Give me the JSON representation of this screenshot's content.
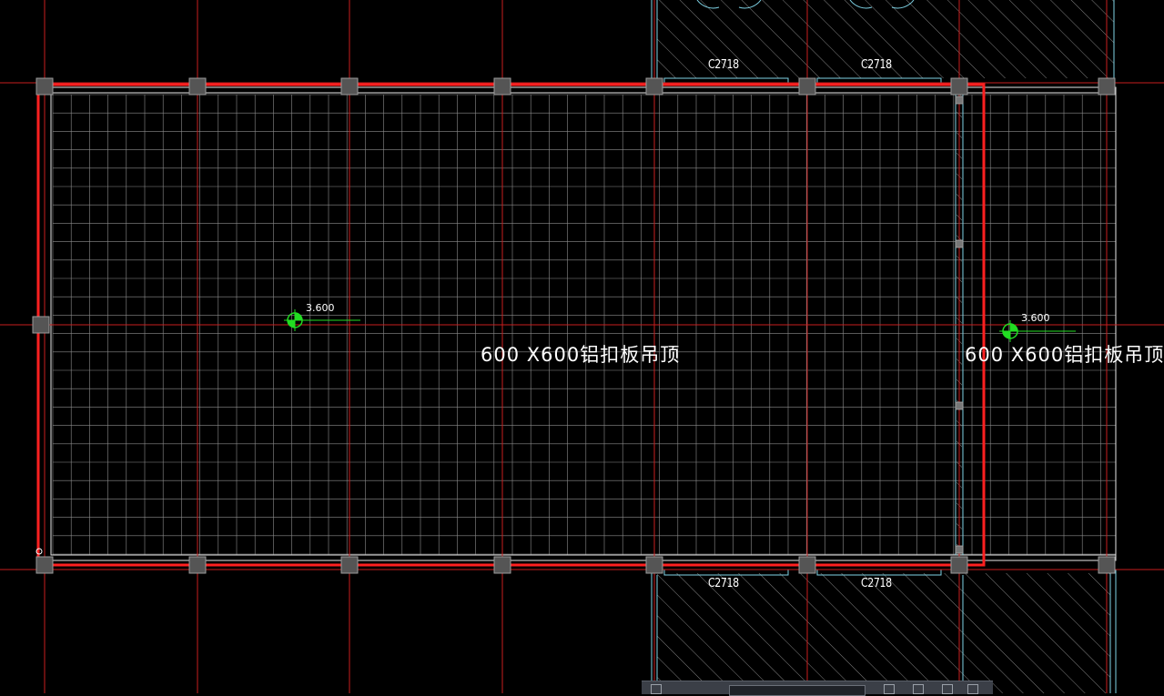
{
  "drawing": {
    "background_color": "#000000",
    "colors": {
      "axis": "#c81e1e",
      "boundary": "#ff2020",
      "wall": "#7fd3e6",
      "grid": "#8c8c8c",
      "outline": "#e8e8e8",
      "column": "#9a9a9a",
      "elevation_marker": "#22dd22",
      "hatch": "#808080"
    },
    "main_room": {
      "ceiling_note": "600 X600铝扣板吊顶",
      "elevation": "3.600",
      "elevation_icon": "elevation-marker-icon"
    },
    "side_room": {
      "ceiling_note": "600 X600铝扣板吊顶",
      "elevation": "3.600",
      "elevation_icon": "elevation-marker-icon"
    },
    "window_tags": {
      "top": [
        "C2718",
        "C2718"
      ],
      "bottom": [
        "C2718",
        "C2718"
      ]
    }
  },
  "toolbar": {
    "icons": [
      "toolbar-link-icon",
      "toolbar-field",
      "toolbar-rect-icon",
      "toolbar-move-icon",
      "toolbar-copy-icon",
      "toolbar-layer-icon"
    ]
  }
}
